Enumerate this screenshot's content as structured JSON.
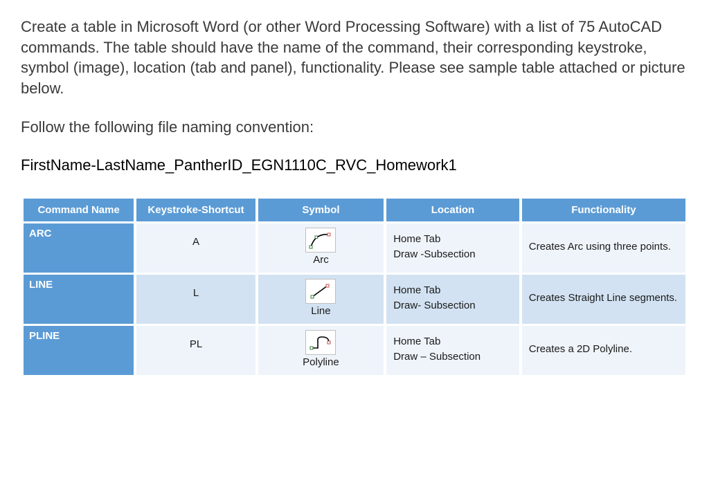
{
  "instructions": "Create a table in Microsoft Word (or other Word Processing Software) with a list of 75 AutoCAD commands.  The table should have the name of the command, their corresponding keystroke, symbol (image), location (tab and panel), functionality. Please see sample table attached or picture below.",
  "subhead": "Follow the following file naming convention:",
  "filename": "FirstName-LastName_PantherID_EGN1110C_RVC_Homework1",
  "columns": {
    "name": "Command Name",
    "keystroke": "Keystroke-Shortcut",
    "symbol": "Symbol",
    "location": "Location",
    "functionality": "Functionality"
  },
  "rows": [
    {
      "name": "ARC",
      "keystroke": "A",
      "icon": "arc-icon",
      "icon_label": "Arc",
      "location_line1": "Home Tab",
      "location_line2": "Draw -Subsection",
      "functionality": "Creates Arc using three points."
    },
    {
      "name": "LINE",
      "keystroke": "L",
      "icon": "line-icon",
      "icon_label": "Line",
      "location_line1": "Home Tab",
      "location_line2": "Draw- Subsection",
      "functionality": "Creates Straight Line segments."
    },
    {
      "name": "PLINE",
      "keystroke": "PL",
      "icon": "polyline-icon",
      "icon_label": "Polyline",
      "location_line1": "Home Tab",
      "location_line2": "Draw – Subsection",
      "functionality": "Creates a 2D Polyline."
    }
  ]
}
